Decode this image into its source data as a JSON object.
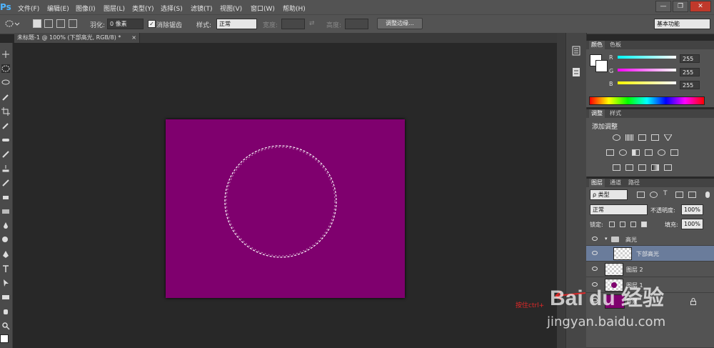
{
  "app": {
    "logo": "Ps"
  },
  "menu": [
    "文件(F)",
    "编辑(E)",
    "图像(I)",
    "图层(L)",
    "类型(Y)",
    "选择(S)",
    "滤镜(T)",
    "视图(V)",
    "窗口(W)",
    "帮助(H)"
  ],
  "window_buttons": [
    "—",
    "❐",
    "✕"
  ],
  "options": {
    "feather_label": "羽化:",
    "feather_value": "0 像素",
    "antialias_label": "消除锯齿",
    "style_label": "样式:",
    "style_value": "正常",
    "width_label": "宽度:",
    "height_label": "高度:",
    "refine_button": "调整边缘...",
    "workspace_value": "基本功能"
  },
  "document": {
    "tab_title": "未标题-1 @ 100% (下部高光, RGB/8) *",
    "tab_close": "×",
    "canvas_color": "#7f006e"
  },
  "color_panel": {
    "tabs": [
      "颜色",
      "色板"
    ],
    "channels": [
      {
        "label": "R",
        "value": "255",
        "gradient": "linear-gradient(to right,#00ffff,#ffffff)"
      },
      {
        "label": "G",
        "value": "255",
        "gradient": "linear-gradient(to right,#ff00ff,#ffffff)"
      },
      {
        "label": "B",
        "value": "255",
        "gradient": "linear-gradient(to right,#ffff00,#ffffff)"
      }
    ]
  },
  "adjust_panel": {
    "tabs": [
      "调整",
      "样式"
    ],
    "title": "添加调整"
  },
  "layers_panel": {
    "tabs": [
      "图层",
      "通道",
      "路径"
    ],
    "filter_value": "ρ 类型",
    "blend_value": "正常",
    "opacity_label": "不透明度:",
    "opacity_value": "100%",
    "lock_label": "锁定:",
    "fill_label": "填充:",
    "fill_value": "100%",
    "layers": [
      {
        "name": "高光",
        "type": "group"
      },
      {
        "name": "下部高光",
        "type": "layer",
        "selected": true
      },
      {
        "name": "图层 2",
        "type": "layer"
      },
      {
        "name": "图层 1",
        "type": "layer"
      },
      {
        "name": "背景",
        "type": "background"
      }
    ]
  },
  "annotation": {
    "text": "按住ctrl+"
  },
  "watermark": {
    "brand": "Bai du 经验",
    "url": "jingyan.baidu.com"
  }
}
